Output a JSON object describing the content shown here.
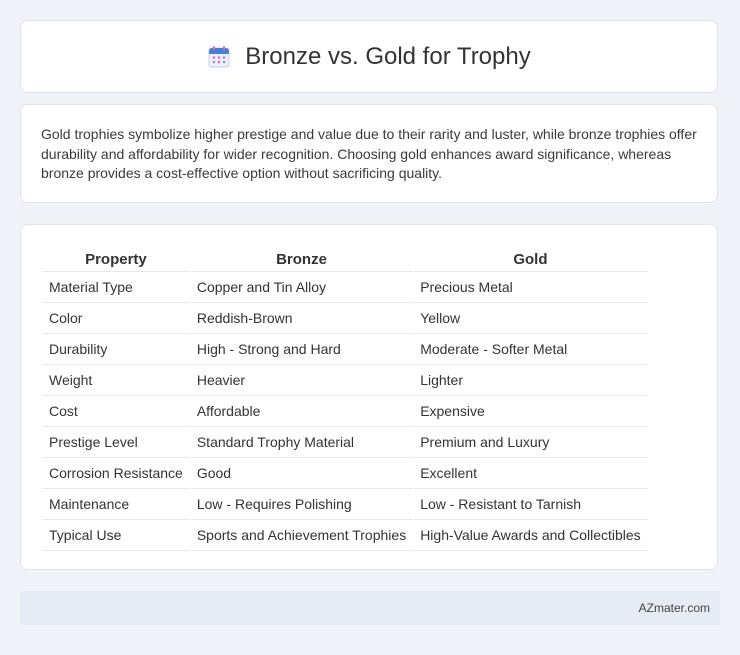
{
  "header": {
    "title": "Bronze vs. Gold for Trophy",
    "icon": "calendar-icon"
  },
  "intro": "Gold trophies symbolize higher prestige and value due to their rarity and luster, while bronze trophies offer durability and affordability for wider recognition. Choosing gold enhances award significance, whereas bronze provides a cost-effective option without sacrificing quality.",
  "table": {
    "headers": [
      "Property",
      "Bronze",
      "Gold"
    ],
    "rows": [
      [
        "Material Type",
        "Copper and Tin Alloy",
        "Precious Metal"
      ],
      [
        "Color",
        "Reddish-Brown",
        "Yellow"
      ],
      [
        "Durability",
        "High - Strong and Hard",
        "Moderate - Softer Metal"
      ],
      [
        "Weight",
        "Heavier",
        "Lighter"
      ],
      [
        "Cost",
        "Affordable",
        "Expensive"
      ],
      [
        "Prestige Level",
        "Standard Trophy Material",
        "Premium and Luxury"
      ],
      [
        "Corrosion Resistance",
        "Good",
        "Excellent"
      ],
      [
        "Maintenance",
        "Low - Requires Polishing",
        "Low - Resistant to Tarnish"
      ],
      [
        "Typical Use",
        "Sports and Achievement Trophies",
        "High-Value Awards and Collectibles"
      ]
    ]
  },
  "footer": {
    "brand": "AZmater.com"
  },
  "colors": {
    "background": "#f0f3f8",
    "card": "#ffffff",
    "footer_bg": "#e6ebf5",
    "icon_blue": "#4a7fd6",
    "icon_pink": "#e86aa8"
  }
}
